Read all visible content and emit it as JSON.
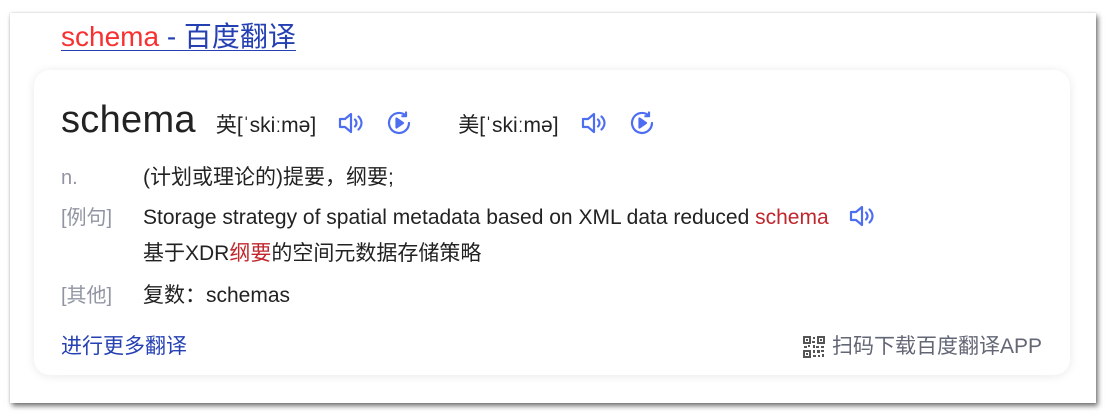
{
  "result": {
    "title_highlight": "schema",
    "title_rest": " - 百度翻译"
  },
  "entry": {
    "word": "schema",
    "uk_phonetic": "英[ˈskiːmə]",
    "us_phonetic": "美[ˈskiːmə]"
  },
  "definition": {
    "pos": "n.",
    "meaning": "(计划或理论的)提要，纲要;"
  },
  "example": {
    "label": "[例句]",
    "sentence_before": "Storage strategy of spatial metadata based on XML data reduced ",
    "sentence_highlight": "schema",
    "translation_before": "基于XDR",
    "translation_highlight": "纲要",
    "translation_after": "的空间元数据存储策略"
  },
  "other": {
    "label": "[其他]",
    "value": "复数：schemas"
  },
  "footer": {
    "more_link": "进行更多翻译",
    "app_promo": "扫码下载百度翻译APP"
  },
  "icons": {
    "speaker": "speaker-icon",
    "play": "play-circle-icon",
    "qr": "qr-code-icon"
  },
  "colors": {
    "link": "#2440b3",
    "highlight": "#f73131",
    "example_highlight": "#c0272d",
    "icon": "#4e6ef2",
    "label": "#9195a3"
  }
}
